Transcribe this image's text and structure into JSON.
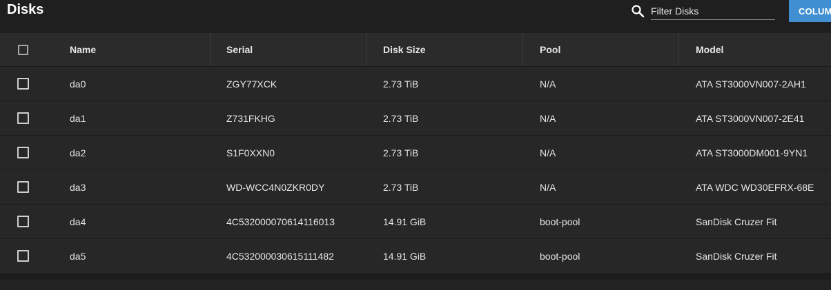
{
  "header": {
    "title": "Disks",
    "search_placeholder": "Filter Disks",
    "columns_button": "COLUMNS"
  },
  "table": {
    "columns": [
      "Name",
      "Serial",
      "Disk Size",
      "Pool",
      "Model"
    ],
    "rows": [
      {
        "name": "da0",
        "serial": "ZGY77XCK",
        "size": "2.73 TiB",
        "pool": "N/A",
        "model": "ATA ST3000VN007-2AH1"
      },
      {
        "name": "da1",
        "serial": "Z731FKHG",
        "size": "2.73 TiB",
        "pool": "N/A",
        "model": "ATA ST3000VN007-2E41"
      },
      {
        "name": "da2",
        "serial": "S1F0XXN0",
        "size": "2.73 TiB",
        "pool": "N/A",
        "model": "ATA ST3000DM001-9YN1"
      },
      {
        "name": "da3",
        "serial": "WD-WCC4N0ZKR0DY",
        "size": "2.73 TiB",
        "pool": "N/A",
        "model": "ATA WDC WD30EFRX-68E"
      },
      {
        "name": "da4",
        "serial": "4C532000070614116013",
        "size": "14.91 GiB",
        "pool": "boot-pool",
        "model": "SanDisk Cruzer Fit"
      },
      {
        "name": "da5",
        "serial": "4C532000030615111482",
        "size": "14.91 GiB",
        "pool": "boot-pool",
        "model": "SanDisk Cruzer Fit"
      }
    ]
  },
  "colors": {
    "accent": "#3f8fd2",
    "background": "#1e1e1e",
    "row": "#272727",
    "header_row": "#2b2b2b"
  }
}
